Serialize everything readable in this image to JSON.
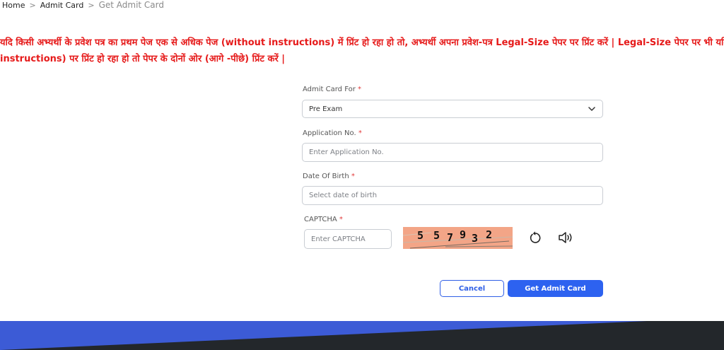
{
  "breadcrumb": {
    "home": "Home",
    "admit_card": "Admit Card",
    "current": "Get Admit Card",
    "separator": ">"
  },
  "notice": {
    "line1": "यदि किसी अभ्यर्थी के प्रवेश पत्र का प्रथम पेज एक से अधिक पेज (without instructions) में प्रिंट हो रहा हो तो, अभ्यर्थी अपना प्रवेश-पत्र Legal-Size पेपर पर प्रिंट करें | Legal-Size पेपर पर भी यदि प्र",
    "line2": "instructions) पर प्रिंट हो रहा हो तो पेपर के दोनों ओर (आगे -पीछे) प्रिंट करें |",
    "color": "#e61a1a"
  },
  "form": {
    "admit_card_for": {
      "label": "Admit Card For",
      "required_mark": "*",
      "value": "Pre Exam"
    },
    "application_no": {
      "label": "Application No.",
      "required_mark": "*",
      "placeholder": "Enter Application No."
    },
    "dob": {
      "label": "Date Of Birth",
      "required_mark": "*",
      "placeholder": "Select date of birth"
    },
    "captcha": {
      "label": "CAPTCHA",
      "required_mark": "*",
      "placeholder": "Enter CAPTCHA",
      "digits": [
        "5",
        "5",
        "7",
        "9",
        "3",
        "2"
      ],
      "background_color": "#f3a587",
      "refresh_icon": "refresh-icon",
      "audio_icon": "speaker-icon"
    },
    "buttons": {
      "cancel": "Cancel",
      "submit": "Get Admit Card"
    }
  },
  "colors": {
    "primary": "#2d62f0",
    "footer_blue": "#3c5bd6",
    "footer_dark": "#23272b"
  }
}
